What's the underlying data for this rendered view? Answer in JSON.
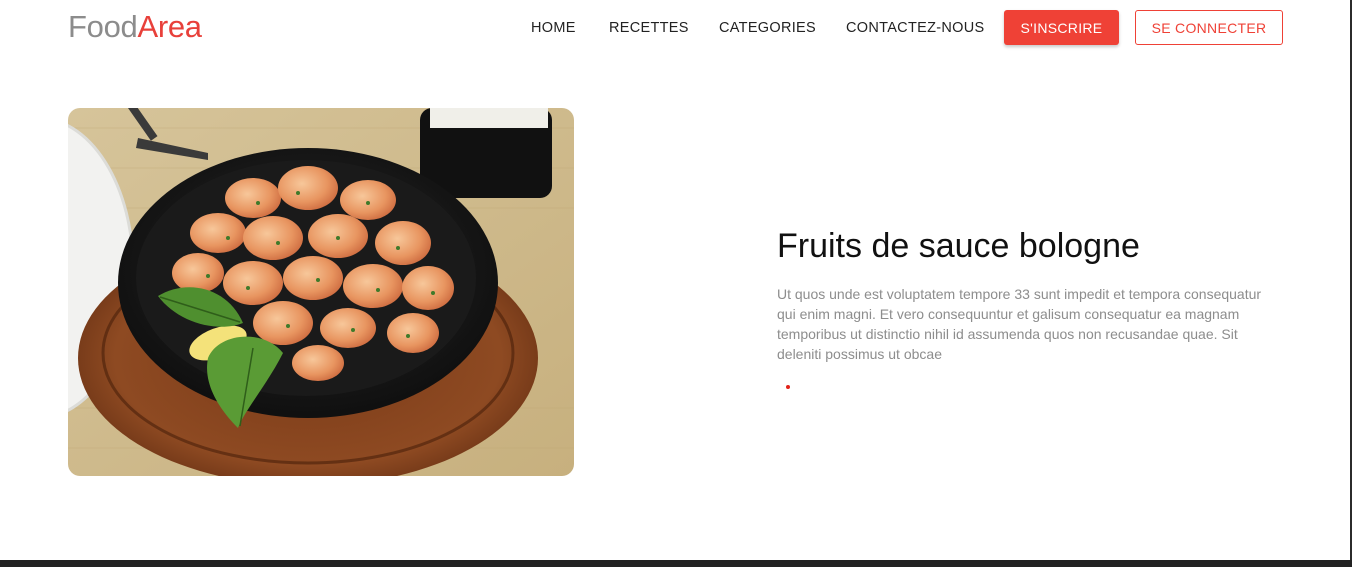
{
  "brand": {
    "part1": "Food",
    "part2": "Area",
    "color_gray": "#8c8c8c",
    "color_red": "#e8403a"
  },
  "nav": {
    "items": [
      {
        "label": "HOME"
      },
      {
        "label": "RECETTES"
      },
      {
        "label": "CATEGORIES"
      },
      {
        "label": "CONTACTEZ-NOUS"
      }
    ],
    "signup_label": "S'INSCRIRE",
    "login_label": "SE CONNECTER",
    "accent_color": "#ef4136"
  },
  "hero": {
    "image_alt": "Crevettes grillées au persil et basilic dans un bol en fonte sur planche en bois",
    "title": "Fruits de sauce bologne",
    "description": "Ut quos unde est voluptatem tempore 33 sunt impedit et tempora consequatur qui enim magni. Et vero consequuntur et galisum consequatur ea magnam temporibus ut distinctio nihil id assumenda quos non recusandae quae. Sit deleniti possimus ut obcae",
    "dot_color": "#e2231a"
  },
  "footer": {
    "bar_color": "#222222"
  }
}
